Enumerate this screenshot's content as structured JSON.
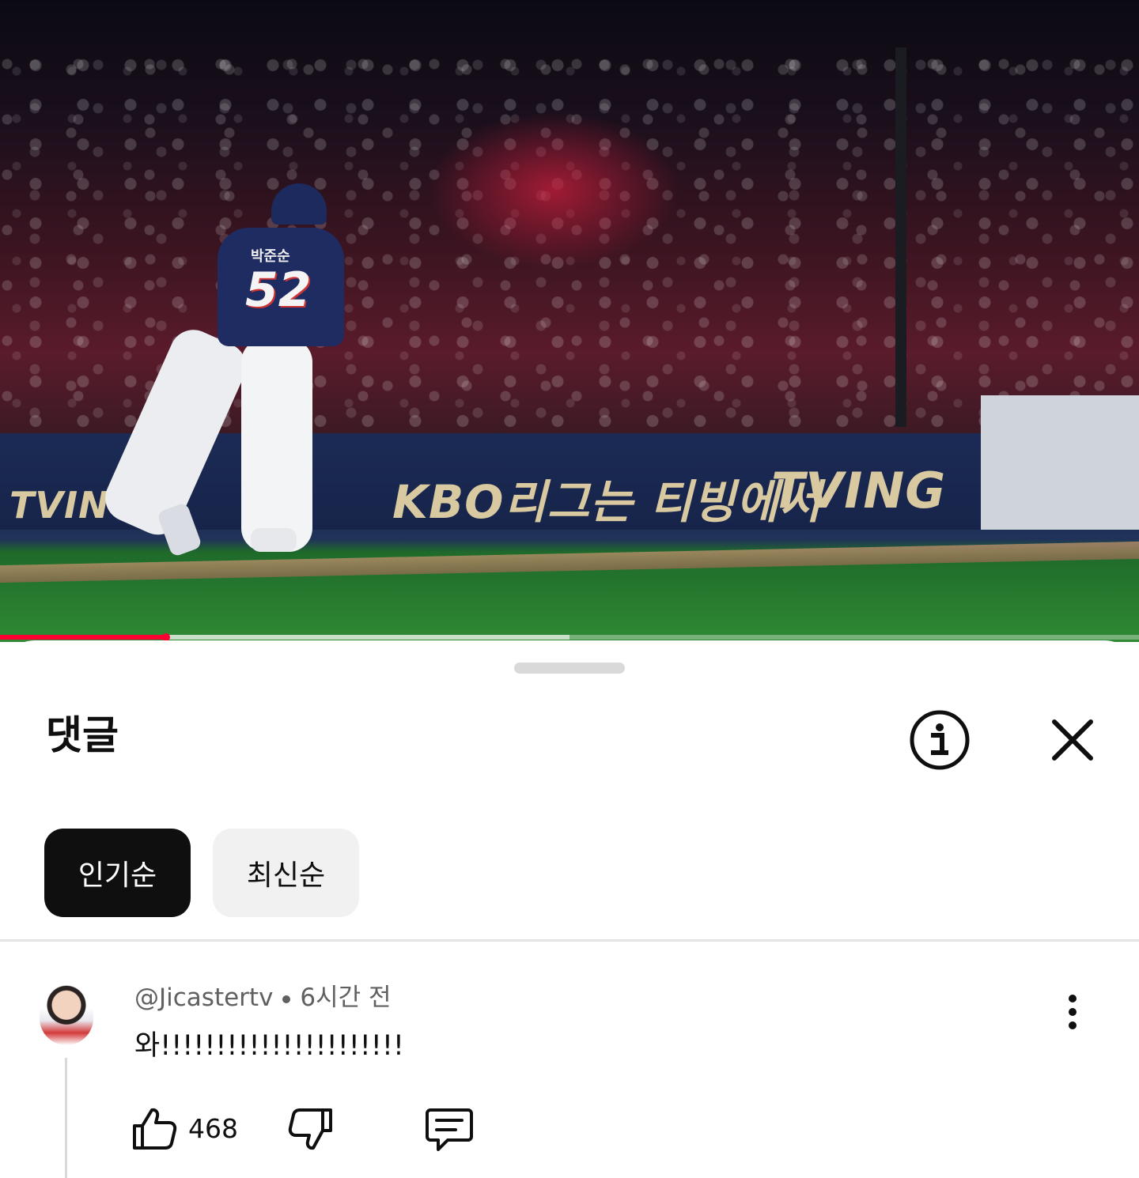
{
  "video": {
    "ad_left_text": "TVING",
    "ad_main_text": "KBO리그는 티빙에서",
    "ad_tving_text": "TVING",
    "jersey_name": "박준순",
    "jersey_number": "52",
    "progress_played_fraction": 0.146,
    "progress_buffered_fraction": 0.5
  },
  "sheet": {
    "title": "댓글",
    "info_icon": "info-icon",
    "close_icon": "close-icon"
  },
  "sort_chips": [
    {
      "label": "인기순",
      "active": true
    },
    {
      "label": "최신순",
      "active": false
    }
  ],
  "comments": [
    {
      "author": "@Jicastertv",
      "time": "6시간 전",
      "text": "와!!!!!!!!!!!!!!!!!!!!!!",
      "likes": "468",
      "icons": [
        "thumbs-up-icon",
        "thumbs-down-icon",
        "reply-icon",
        "more-vertical-icon"
      ]
    }
  ],
  "colors": {
    "accent": "#ff0033",
    "chip_active_bg": "#0f0f0f",
    "chip_inactive_bg": "#f1f1f1",
    "meta_text": "#606060"
  }
}
